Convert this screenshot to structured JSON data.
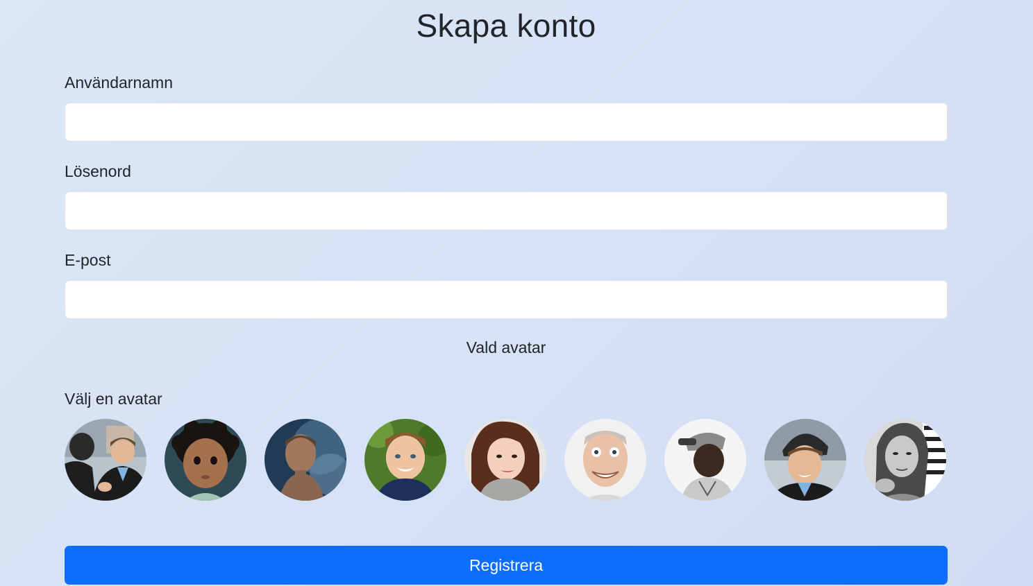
{
  "page": {
    "title": "Skapa konto"
  },
  "form": {
    "username": {
      "label": "Användarnamn",
      "value": "",
      "placeholder": ""
    },
    "password": {
      "label": "Lösenord",
      "value": "",
      "placeholder": ""
    },
    "email": {
      "label": "E-post",
      "value": "",
      "placeholder": ""
    },
    "selected_avatar_label": "Vald avatar",
    "choose_avatar_label": "Välj en avatar",
    "avatars": [
      {
        "name": "avatar-two-men-talking"
      },
      {
        "name": "avatar-curly-haired-toddler"
      },
      {
        "name": "avatar-man-in-smoke"
      },
      {
        "name": "avatar-smiling-boy"
      },
      {
        "name": "avatar-young-woman"
      },
      {
        "name": "avatar-funny-face-man"
      },
      {
        "name": "avatar-person-in-cap"
      },
      {
        "name": "avatar-man-with-beanie"
      },
      {
        "name": "avatar-woman-black-white"
      }
    ],
    "submit_label": "Registrera"
  },
  "colors": {
    "primary": "#0d6efd",
    "background": "#d6e2f5",
    "text": "#212529"
  }
}
